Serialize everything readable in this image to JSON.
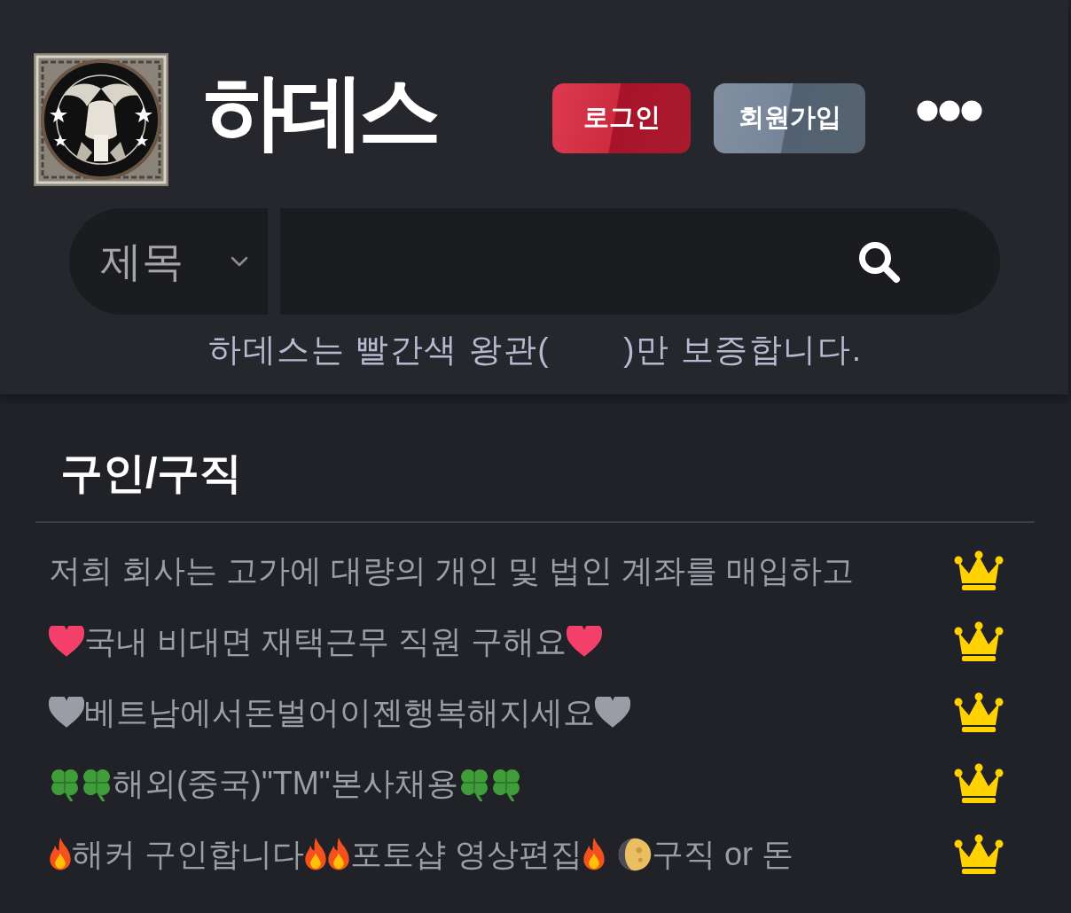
{
  "header": {
    "title": "하데스",
    "buttons": [
      {
        "label": "로그인",
        "kind": "login"
      },
      {
        "label": "회원가입",
        "kind": "signup"
      }
    ]
  },
  "search": {
    "field": "제목"
  },
  "notice": "하데스는 빨간색 왕관(       )만 보증합니다.",
  "board": {
    "title": "구인/구직",
    "posts": [
      {
        "crown": true,
        "parts": [
          {
            "kind": "text",
            "text": "저희 회사는 고가에 대량의 개인 및 법인 계좌를 매입하고"
          }
        ]
      },
      {
        "crown": true,
        "parts": [
          {
            "kind": "heart",
            "color": "#f43f6b"
          },
          {
            "kind": "text",
            "text": "국내 비대면 재택근무 직원 구해요"
          },
          {
            "kind": "heart",
            "color": "#f43f6b"
          }
        ]
      },
      {
        "crown": true,
        "parts": [
          {
            "kind": "heart",
            "color": "#9c9ca6"
          },
          {
            "kind": "text",
            "text": "베트남에서돈벌어이젠행복해지세요"
          },
          {
            "kind": "heart",
            "color": "#9c9ca6"
          }
        ]
      },
      {
        "crown": true,
        "parts": [
          {
            "kind": "clover"
          },
          {
            "kind": "clover"
          },
          {
            "kind": "text",
            "text": "해외(중국)\"TM\"본사채용"
          },
          {
            "kind": "clover"
          },
          {
            "kind": "clover"
          }
        ]
      },
      {
        "crown": true,
        "parts": [
          {
            "kind": "fire"
          },
          {
            "kind": "text",
            "text": "해커 구인합니다"
          },
          {
            "kind": "fire"
          },
          {
            "kind": "fire"
          },
          {
            "kind": "text",
            "text": "포토샵 영상편집"
          },
          {
            "kind": "fire"
          },
          {
            "kind": "moon"
          },
          {
            "kind": "text",
            "text": "구직 or 돈"
          }
        ]
      }
    ]
  }
}
